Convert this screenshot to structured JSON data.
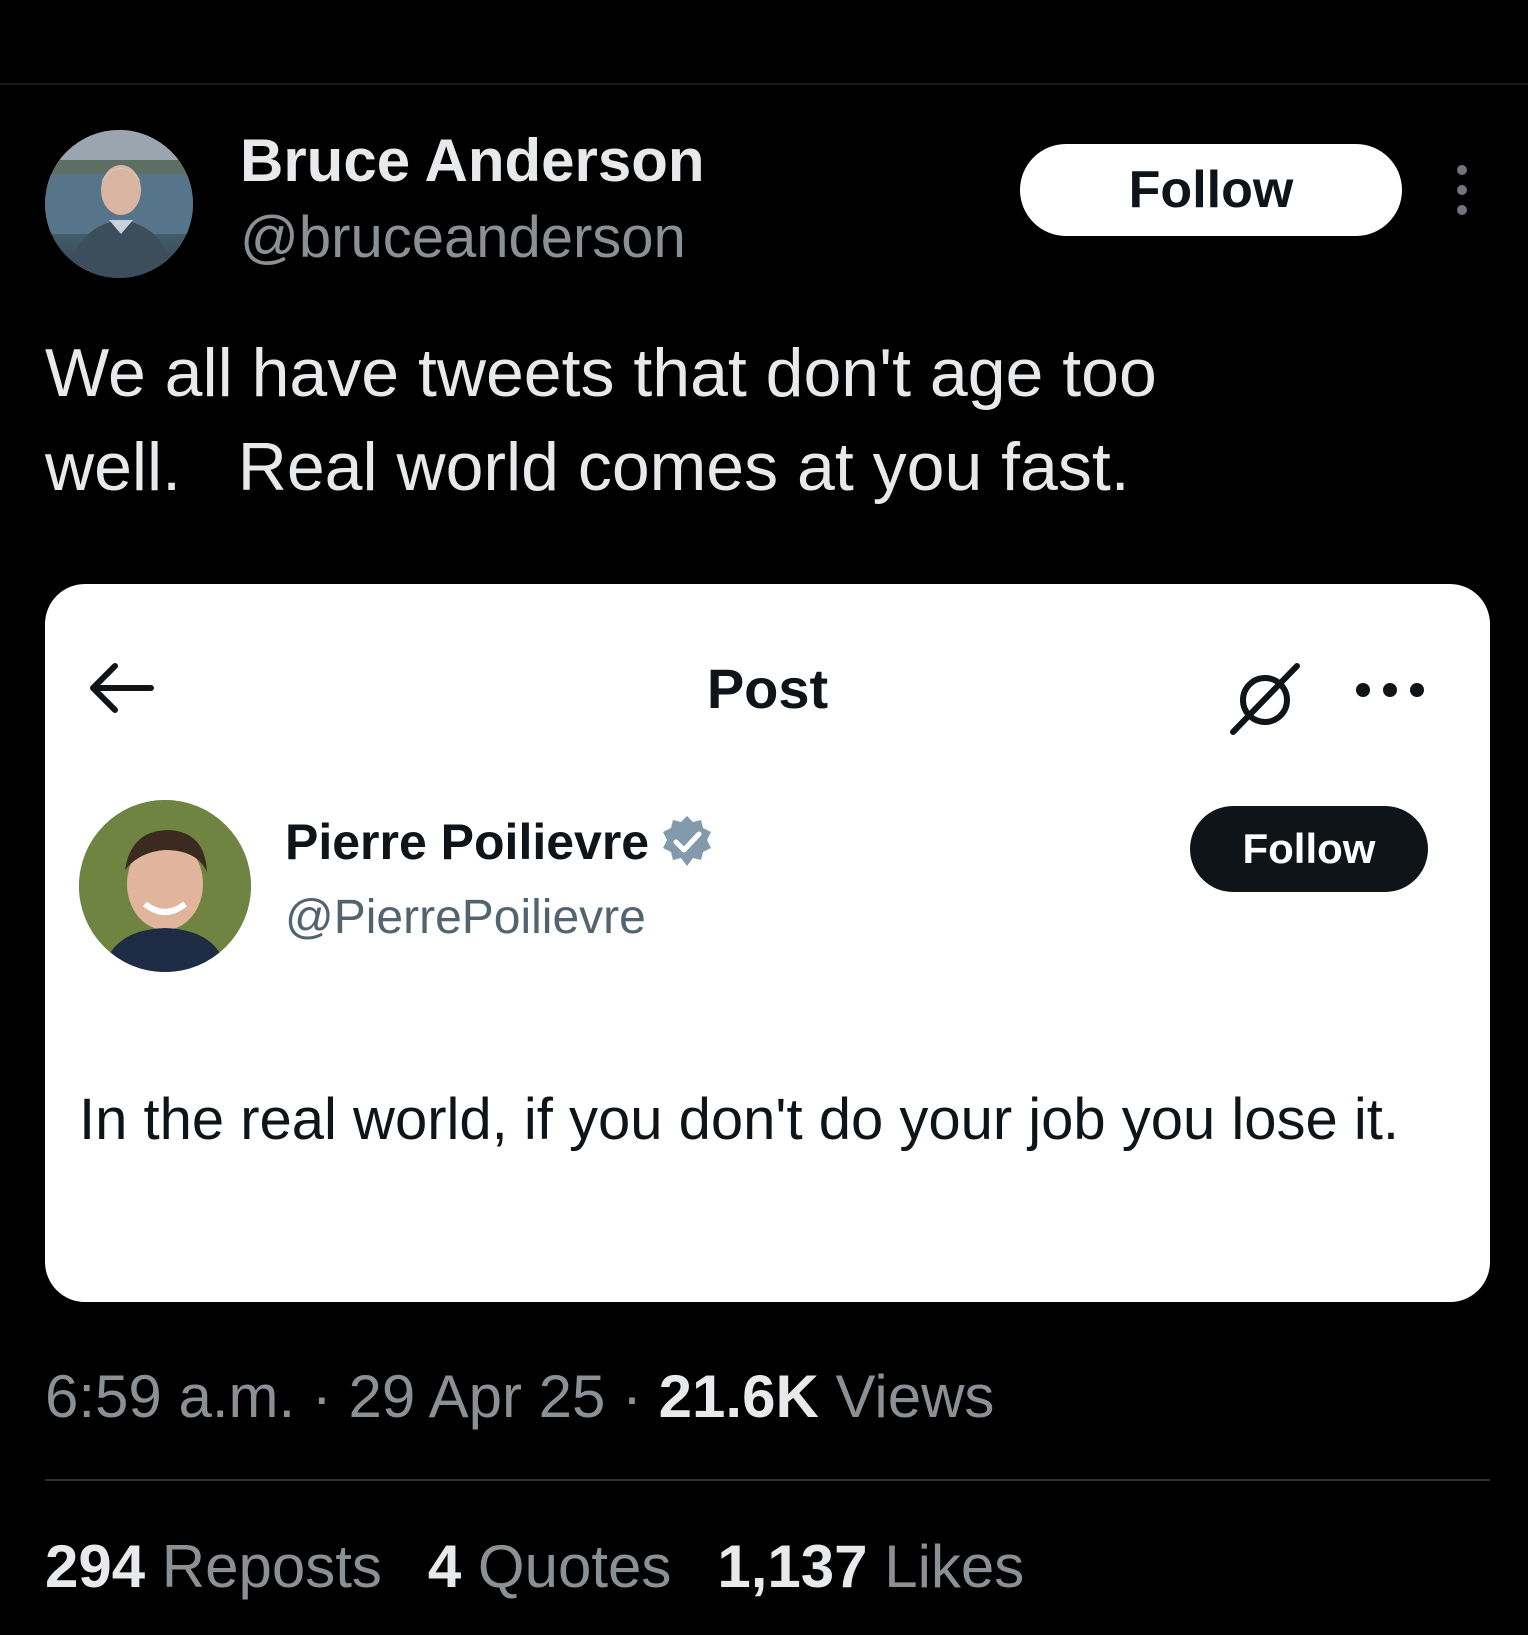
{
  "author": {
    "name": "Bruce Anderson",
    "handle": "@bruceanderson",
    "follow_label": "Follow"
  },
  "tweet": {
    "text": "We all have tweets that don't age too\nwell.   Real world comes at you fast."
  },
  "embedded_screenshot": {
    "header_title": "Post",
    "author_name": "Pierre Poilievre",
    "author_handle": "@PierrePoilievre",
    "follow_label": "Follow",
    "text": "In the real world, if you don't do your job you lose it."
  },
  "meta": {
    "time": "6:59 a.m.",
    "separator": " · ",
    "date": "29 Apr 25",
    "views_count": "21.6K",
    "views_label": " Views"
  },
  "stats": {
    "reposts_count": "294",
    "reposts_label": " Reposts",
    "quotes_count": "4",
    "quotes_label": " Quotes",
    "likes_count": "1,137",
    "likes_label": " Likes"
  },
  "icons": {
    "more_vertical": "more-vertical-icon",
    "back": "back-arrow-icon",
    "grok": "grok-icon",
    "more_horizontal": "more-horizontal-icon",
    "verified": "verified-badge-icon"
  },
  "colors": {
    "background": "#000000",
    "text_primary": "#e7e9ea",
    "text_secondary": "#8b9095",
    "verified_badge": "#829aab"
  }
}
